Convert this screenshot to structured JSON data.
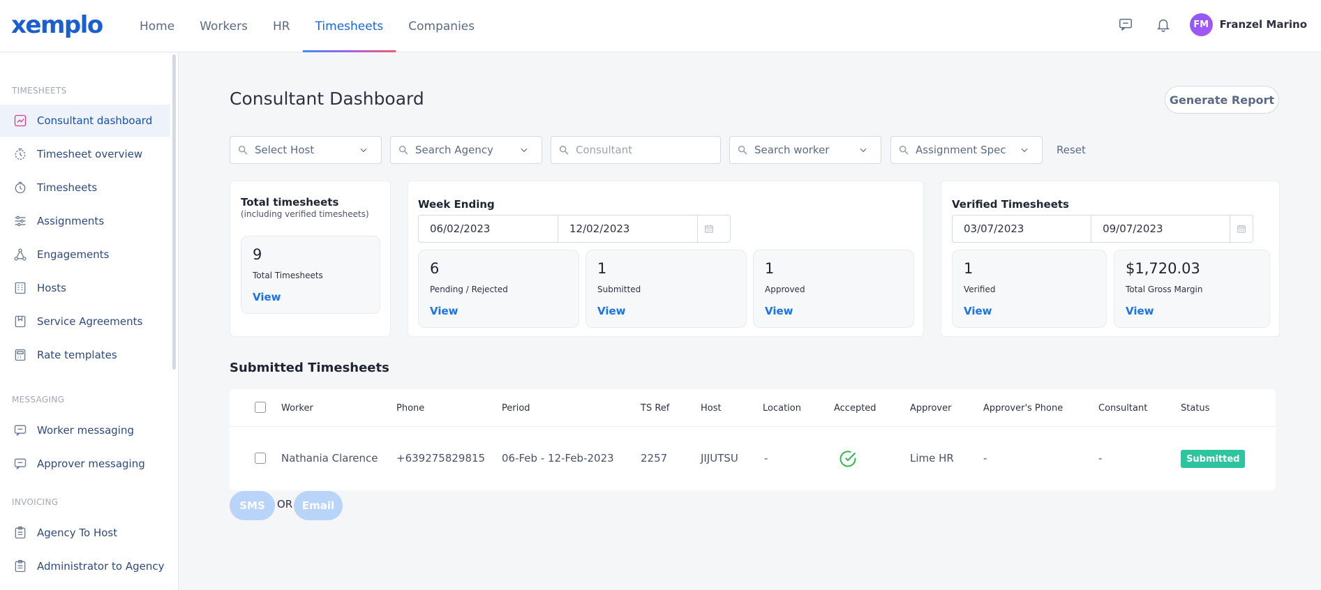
{
  "app": {
    "logo": "xemplo"
  },
  "nav": {
    "items": [
      {
        "label": "Home"
      },
      {
        "label": "Workers"
      },
      {
        "label": "HR"
      },
      {
        "label": "Timesheets"
      },
      {
        "label": "Companies"
      }
    ],
    "active": "Timesheets"
  },
  "user": {
    "initials": "FM",
    "name": "Franzel Marino"
  },
  "sidebar": {
    "sections": [
      {
        "title": "TIMESHEETS"
      },
      {
        "title": "MESSAGING"
      },
      {
        "title": "INVOICING"
      }
    ],
    "items": [
      {
        "label": "Consultant dashboard",
        "icon": "chart-icon"
      },
      {
        "label": "Timesheet overview",
        "icon": "clock-dashed-icon"
      },
      {
        "label": "Timesheets",
        "icon": "stopwatch-icon"
      },
      {
        "label": "Assignments",
        "icon": "sliders-icon"
      },
      {
        "label": "Engagements",
        "icon": "network-icon"
      },
      {
        "label": "Hosts",
        "icon": "building-icon"
      },
      {
        "label": "Service Agreements",
        "icon": "bookmark-icon"
      },
      {
        "label": "Rate templates",
        "icon": "calculator-icon"
      },
      {
        "label": "Worker messaging",
        "icon": "message-icon"
      },
      {
        "label": "Approver messaging",
        "icon": "message-icon"
      },
      {
        "label": "Agency To Host",
        "icon": "clipboard-icon"
      },
      {
        "label": "Administrator to Agency",
        "icon": "clipboard-icon"
      }
    ]
  },
  "page": {
    "title": "Consultant Dashboard",
    "generate_report": "Generate Report"
  },
  "filters": {
    "host": "Select Host",
    "agency": "Search Agency",
    "consultant_placeholder": "Consultant",
    "worker": "Search worker",
    "assignment": "Assignment Spec",
    "reset": "Reset"
  },
  "total_card": {
    "title": "Total timesheets",
    "subtitle": "(including verified timesheets)",
    "value": "9",
    "label": "Total Timesheets",
    "view": "View"
  },
  "week_card": {
    "title": "Week Ending",
    "date_from": "06/02/2023",
    "date_to": "12/02/2023",
    "stats": [
      {
        "value": "6",
        "label": "Pending / Rejected",
        "view": "View"
      },
      {
        "value": "1",
        "label": "Submitted",
        "view": "View"
      },
      {
        "value": "1",
        "label": "Approved",
        "view": "View"
      }
    ]
  },
  "verified_card": {
    "title": "Verified Timesheets",
    "date_from": "03/07/2023",
    "date_to": "09/07/2023",
    "stats": [
      {
        "value": "1",
        "label": "Verified",
        "view": "View"
      },
      {
        "value": "$1,720.03",
        "label": "Total Gross Margin",
        "view": "View"
      }
    ]
  },
  "submitted": {
    "title": "Submitted Timesheets",
    "columns": [
      "Worker",
      "Phone",
      "Period",
      "TS Ref",
      "Host",
      "Location",
      "Accepted",
      "Approver",
      "Approver's Phone",
      "Consultant",
      "Status"
    ],
    "rows": [
      {
        "worker": "Nathania Clarence",
        "phone": "+639275829815",
        "period": "06-Feb - 12-Feb-2023",
        "ts_ref": "2257",
        "host": "JIJUTSU",
        "location": "-",
        "accepted": true,
        "approver": "Lime HR",
        "approver_phone": "-",
        "consultant": "-",
        "status": "Submitted"
      }
    ]
  },
  "actions": {
    "sms": "SMS",
    "or": "OR",
    "email": "Email"
  },
  "colors": {
    "accent": "#1a73e8",
    "status_submitted": "#2ec4a0",
    "accepted": "#2eb84a"
  }
}
